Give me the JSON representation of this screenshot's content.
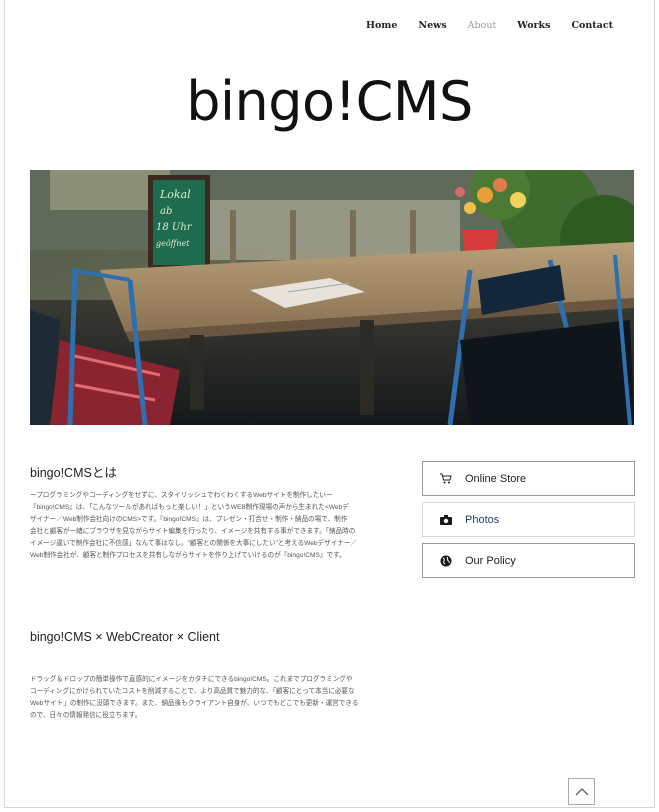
{
  "nav": {
    "items": [
      {
        "label": "Home"
      },
      {
        "label": "News"
      },
      {
        "label": "About"
      },
      {
        "label": "Works"
      },
      {
        "label": "Contact"
      }
    ],
    "active": "About"
  },
  "site": {
    "logo": "bingo!CMS"
  },
  "hero": {
    "sign_text": [
      "Lokal",
      "ab",
      "18 Uhr",
      "geöffnet"
    ],
    "description_icon": "cafe-patio-photo"
  },
  "sections": [
    {
      "title": "bingo!CMSとは",
      "lines": [
        "ープログラミングやコーディングをせずに、スタイリッシュでわくわくするWebサイトを制作したいー",
        "『bingo!CMS』は、「こんなツールがあればもっと楽しい！」というWEB制作現場の声から生まれた<Webデ",
        "ザイナー／Web制作会社向けのCMS>です。『bingo!CMS』は、プレゼン・打合せ・制作・納品の場で、制作",
        "会社と顧客が一緒にブラウザを見ながらサイト編集を行ったり、イメージを共有する事ができます。「納品時の",
        "イメージ違いで制作会社に不信感」なんて事はなし。\"顧客との関係を大事にしたい\"と考えるWebデザイナー／",
        "Web制作会社が、顧客と制作プロセスを共有しながらサイトを作り上げていけるのが『bingo!CMS』です。"
      ]
    },
    {
      "title": "bingo!CMS × WebCreator × Client",
      "lines": [
        "ドラッグ＆ドロップの簡単操作で直感的にイメージをカタチにできるbingo!CMS。これまでプログラミングや",
        "コーディングにかけられていたコストを削減することで、より高品質で魅力的な、「顧客にとって本当に必要な",
        "Webサイト」の制作に没頭できます。また、納品後もクライアント自身が、いつでもどこでも更新・運営できる",
        "ので、日々の情報発信に役立ちます。"
      ]
    }
  ],
  "side_menu": [
    {
      "label": "Online Store",
      "icon": "cart-icon",
      "current": false
    },
    {
      "label": "Photos",
      "icon": "camera-icon",
      "current": true
    },
    {
      "label": "Our Policy",
      "icon": "globe-icon",
      "current": false
    }
  ],
  "colors": {
    "accent": "#1f3f73",
    "border": "#9a9a9a",
    "nav_active": "#9a9a9a"
  },
  "back_to_top": {
    "icon": "chevron-up-icon"
  }
}
